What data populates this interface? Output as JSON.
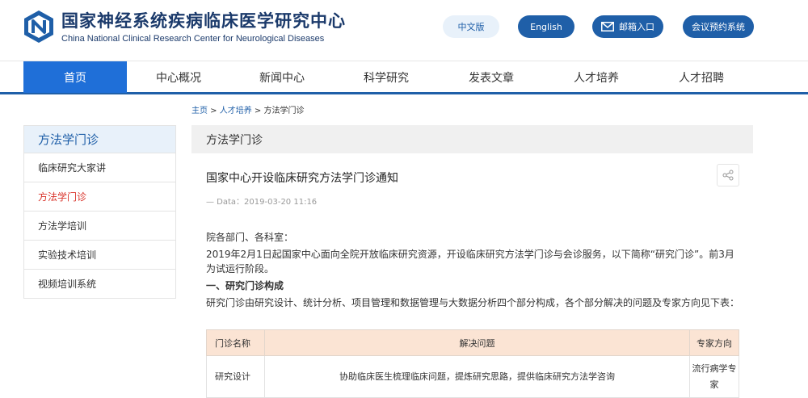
{
  "header": {
    "title_cn": "国家神经系统疾病临床医学研究中心",
    "title_en": "China National Clinical Research Center for Neurological Diseases",
    "btn_cn": "中文版",
    "btn_en": "English",
    "btn_mail": "邮箱入口",
    "btn_meeting": "会议预约系统",
    "brand_color": "#1f5fa8"
  },
  "nav": {
    "items": [
      "首页",
      "中心概况",
      "新闻中心",
      "科学研究",
      "发表文章",
      "人才培养",
      "人才招聘"
    ],
    "active_index": 0
  },
  "breadcrumb": {
    "home": "主页",
    "sep": " > ",
    "level1": "人才培养",
    "current": "方法学门诊"
  },
  "sidebar": {
    "heading": "方法学门诊",
    "items": [
      "临床研究大家讲",
      "方法学门诊",
      "方法学培训",
      "实验技术培训",
      "视频培训系统"
    ],
    "active_index": 1,
    "active_color": "#d9342b"
  },
  "main": {
    "heading": "方法学门诊",
    "article_title": "国家中心开设临床研究方法学门诊通知",
    "date_line": "—  Data：2019-03-20 11:16",
    "para_greeting": "院各部门、各科室：",
    "para_1": "2019年2月1日起国家中心面向全院开放临床研究资源，开设临床研究方法学门诊与会诊服务，以下简称“研究门诊”。前3月为试运行阶段。",
    "section_1": "一、研究门诊构成",
    "para_2": "研究门诊由研究设计、统计分析、项目管理和数据管理与大数据分析四个部分构成，各个部分解决的问题及专家方向见下表：",
    "table": {
      "headers": [
        "门诊名称",
        "解决问题",
        "专家方向"
      ],
      "rows": [
        [
          "研究设计",
          "协助临床医生梳理临床问题，提炼研究思路，提供临床研究方法学咨询",
          "流行病学专家"
        ]
      ]
    }
  }
}
